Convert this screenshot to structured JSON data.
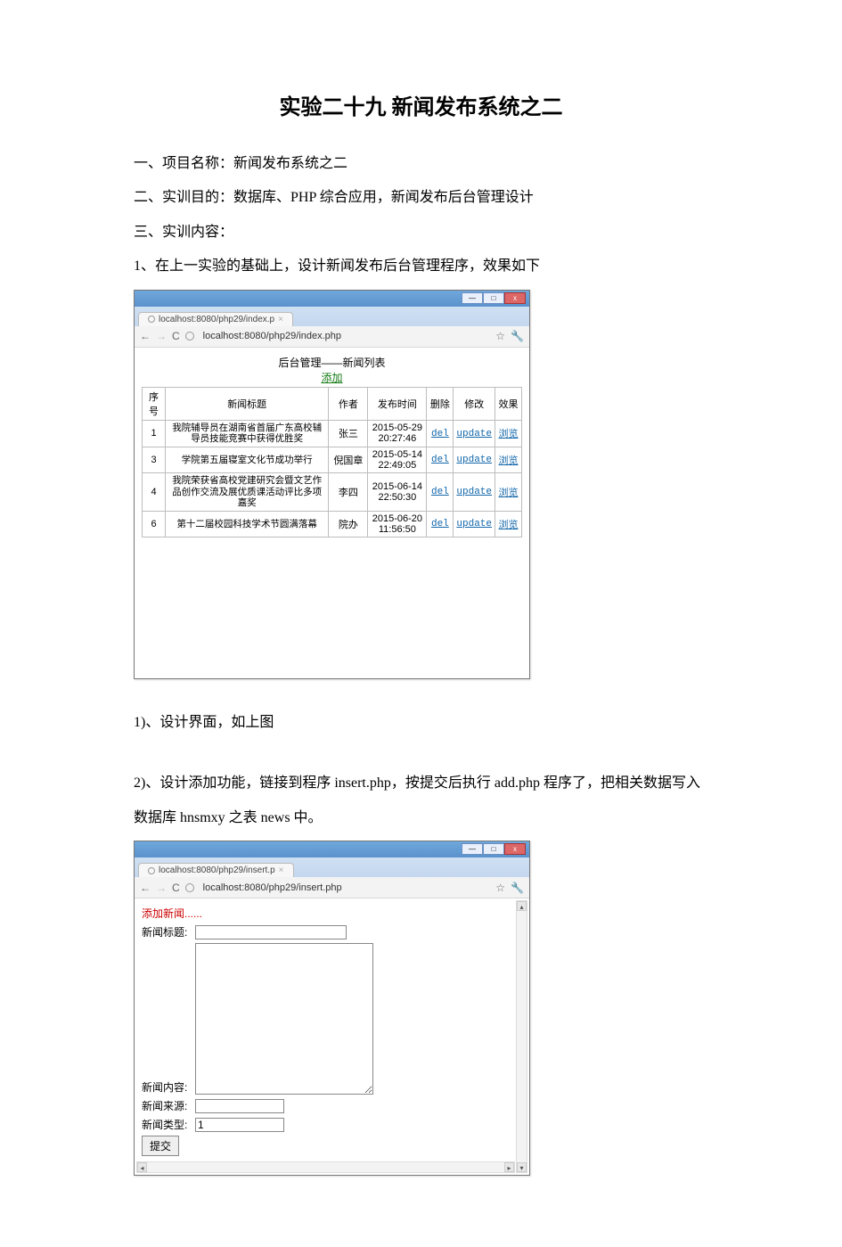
{
  "doc": {
    "title": "实验二十九   新闻发布系统之二",
    "h1": "一、项目名称：新闻发布系统之二",
    "h2": "二、实训目的：数据库、PHP 综合应用，新闻发布后台管理设计",
    "h3": "三、实训内容：",
    "p1": "1、在上一实验的基础上，设计新闻发布后台管理程序，效果如下",
    "step1_1": "1)、设计界面，如上图",
    "step1_2": "2)、设计添加功能，链接到程序 insert.php，按提交后执行 add.php 程序了，把相关数据写入数据库 hnsmxy 之表 news 中。"
  },
  "win1": {
    "tab_label": "localhost:8080/php29/index.p",
    "url": "localhost:8080/php29/index.php",
    "heading": "后台管理——新闻列表",
    "add_link": "添加",
    "headers": {
      "id": "序号",
      "title": "新闻标题",
      "author": "作者",
      "time": "发布时间",
      "del": "删除",
      "upd": "修改",
      "view": "效果"
    },
    "rows": [
      {
        "id": "1",
        "title": "我院辅导员在湖南省首届广东高校辅导员技能竞赛中获得优胜奖",
        "author": "张三",
        "time": "2015-05-29 20:27:46",
        "del": "del",
        "upd": "update",
        "view": "浏览"
      },
      {
        "id": "3",
        "title": "学院第五届寝室文化节成功举行",
        "author": "倪国章",
        "time": "2015-05-14 22:49:05",
        "del": "del",
        "upd": "update",
        "view": "浏览"
      },
      {
        "id": "4",
        "title": "我院荣获省高校党建研究会暨文艺作品创作交流及展优质课活动评比多项嘉奖",
        "author": "李四",
        "time": "2015-06-14 22:50:30",
        "del": "del",
        "upd": "update",
        "view": "浏览"
      },
      {
        "id": "6",
        "title": "第十二届校园科技学术节圆满落幕",
        "author": "院办",
        "time": "2015-06-20 11:56:50",
        "del": "del",
        "upd": "update",
        "view": "浏览"
      }
    ]
  },
  "win2": {
    "tab_label": "localhost:8080/php29/insert.p",
    "url": "localhost:8080/php29/insert.php",
    "heading": "添加新闻......",
    "labels": {
      "title": "新闻标题:",
      "content": "新闻内容:",
      "source": "新闻来源:",
      "type": "新闻类型:"
    },
    "type_value": "1",
    "submit": "提交"
  },
  "win_ctrl": {
    "min": "—",
    "max": "□",
    "close": "x"
  },
  "nav": {
    "back": "←",
    "fwd": "→",
    "reload": "C",
    "star": "☆",
    "wrench": "🔧"
  }
}
